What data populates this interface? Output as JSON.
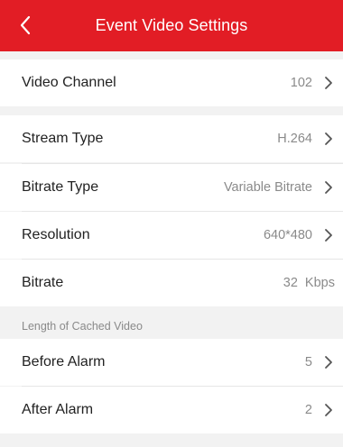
{
  "header": {
    "title": "Event Video Settings",
    "back_icon": "chevron-left-icon",
    "color": "#e21d25"
  },
  "video_channel": {
    "label": "Video Channel",
    "value": "102"
  },
  "stream": {
    "stream_type_label": "Stream Type",
    "stream_type_value": "H.264",
    "bitrate_type_label": "Bitrate Type",
    "bitrate_type_value": "Variable Bitrate",
    "resolution_label": "Resolution",
    "resolution_value": "640*480",
    "bitrate_label": "Bitrate",
    "bitrate_value": "32  Kbps"
  },
  "cache": {
    "section_label": "Length of Cached Video",
    "before_alarm_label": "Before Alarm",
    "before_alarm_value": "5",
    "after_alarm_label": "After Alarm",
    "after_alarm_value": "2"
  }
}
